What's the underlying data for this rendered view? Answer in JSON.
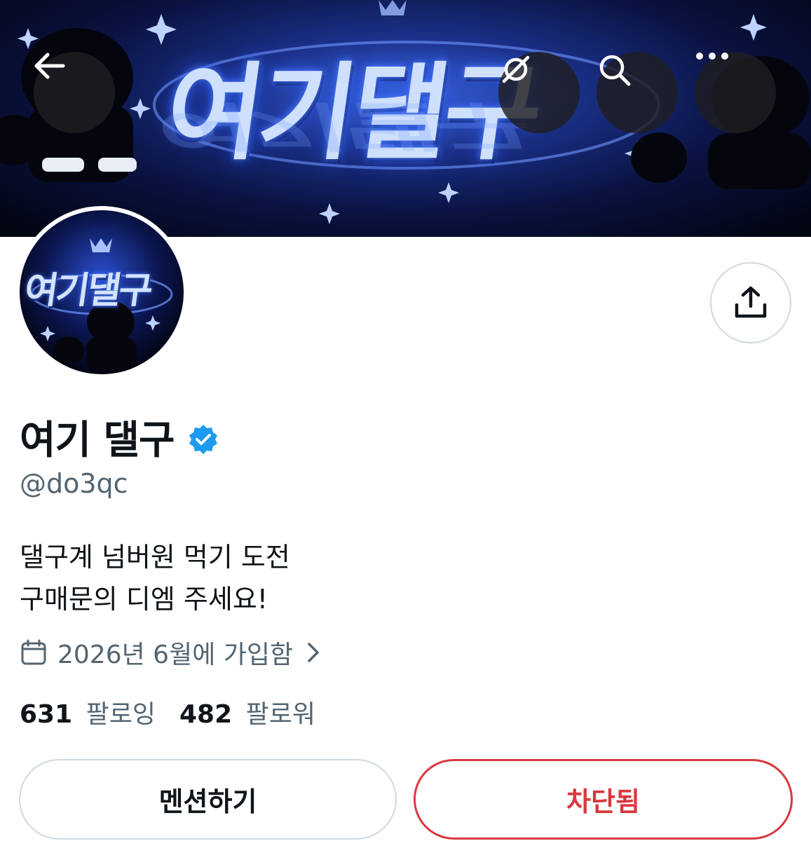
{
  "banner": {
    "art_text": "여기댈구",
    "back_icon": "arrow-left-icon",
    "translate_icon": "no-translate-icon",
    "search_icon": "search-icon",
    "more_icon": "more-horizontal-icon"
  },
  "avatar": {
    "art_text": "여기댈구"
  },
  "share_icon": "share-icon",
  "profile": {
    "name": "여기 댈구",
    "verified": true,
    "handle": "@do3qc",
    "bio_line1": "댈구계 넘버원 먹기 도전",
    "bio_line2": "구매문의 디엠 주세요!",
    "joined": "2026년 6월에 가입함"
  },
  "stats": {
    "following_count": "631",
    "following_label": "팔로잉",
    "followers_count": "482",
    "followers_label": "팔로워"
  },
  "actions": {
    "mention_label": "멘션하기",
    "blocked_label": "차단됨"
  },
  "colors": {
    "verified_blue": "#1d9bf0",
    "blocked_red": "#d9383f",
    "secondary_text": "#536471"
  }
}
